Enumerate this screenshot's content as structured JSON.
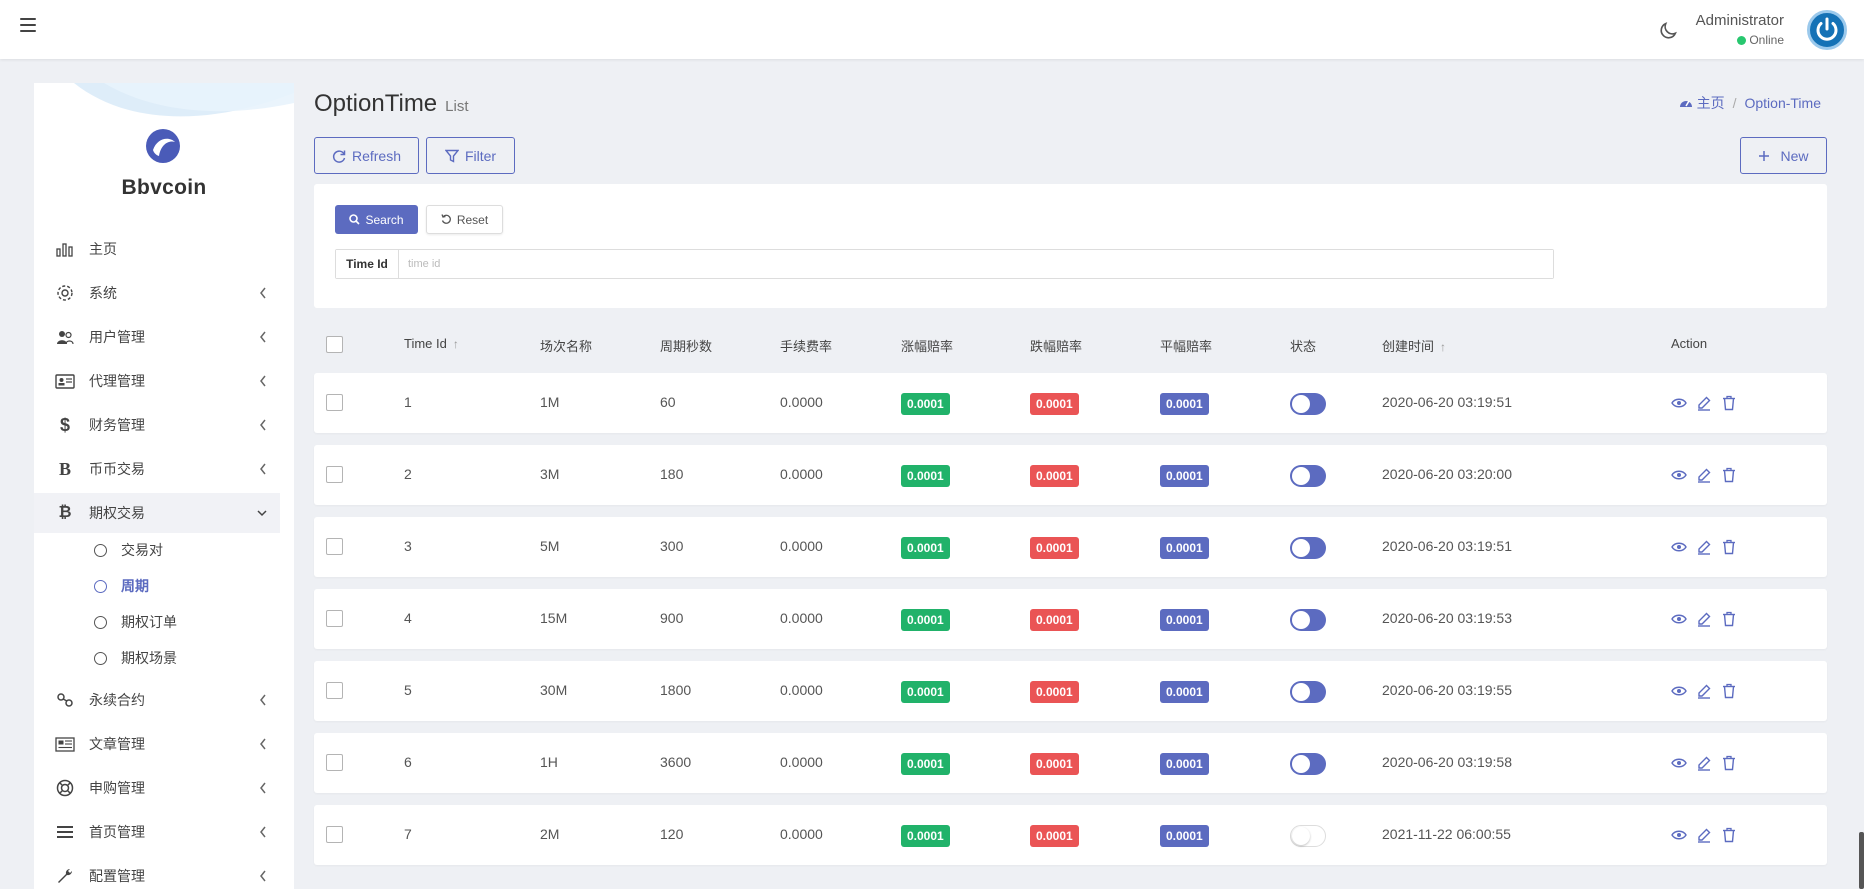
{
  "header": {
    "user_name": "Administrator",
    "user_status": "Online",
    "icons": [
      "hamburger-icon",
      "moon-icon",
      "power-icon"
    ]
  },
  "sidebar": {
    "brand": "Bbvcoin",
    "items": [
      {
        "label": "主页",
        "icon": "bar-chart-icon"
      },
      {
        "label": "系统",
        "icon": "gear-icon"
      },
      {
        "label": "用户管理",
        "icon": "users-icon"
      },
      {
        "label": "代理管理",
        "icon": "id-card-icon"
      },
      {
        "label": "财务管理",
        "icon": "dollar-icon"
      },
      {
        "label": "币币交易",
        "icon": "bold-b-icon"
      },
      {
        "label": "期权交易",
        "icon": "bitcoin-icon"
      },
      {
        "label": "永续合约",
        "icon": "link-icon"
      },
      {
        "label": "文章管理",
        "icon": "newspaper-icon"
      },
      {
        "label": "申购管理",
        "icon": "life-ring-icon"
      },
      {
        "label": "首页管理",
        "icon": "list-icon"
      },
      {
        "label": "配置管理",
        "icon": "wrench-icon"
      }
    ],
    "subitems": [
      {
        "label": "交易对"
      },
      {
        "label": "周期"
      },
      {
        "label": "期权订单"
      },
      {
        "label": "期权场景"
      }
    ]
  },
  "page": {
    "title": "OptionTime",
    "subtitle": "List",
    "breadcrumb_home": "主页",
    "breadcrumb_current": "Option-Time"
  },
  "toolbar": {
    "refresh_label": "Refresh",
    "filter_label": "Filter",
    "new_label": "New"
  },
  "filter": {
    "search_label": "Search",
    "reset_label": "Reset",
    "field_label": "Time Id",
    "field_placeholder": "time id",
    "field_value": ""
  },
  "table": {
    "columns": [
      "Time Id",
      "场次名称",
      "周期秒数",
      "手续费率",
      "涨幅赔率",
      "跌幅赔率",
      "平幅赔率",
      "状态",
      "创建时间",
      "Action"
    ],
    "rows": [
      {
        "id": "1",
        "name": "1M",
        "seconds": "60",
        "fee": "0.0000",
        "up": "0.0001",
        "down": "0.0001",
        "flat": "0.0001",
        "status": true,
        "created": "2020-06-20 03:19:51"
      },
      {
        "id": "2",
        "name": "3M",
        "seconds": "180",
        "fee": "0.0000",
        "up": "0.0001",
        "down": "0.0001",
        "flat": "0.0001",
        "status": true,
        "created": "2020-06-20 03:20:00"
      },
      {
        "id": "3",
        "name": "5M",
        "seconds": "300",
        "fee": "0.0000",
        "up": "0.0001",
        "down": "0.0001",
        "flat": "0.0001",
        "status": true,
        "created": "2020-06-20 03:19:51"
      },
      {
        "id": "4",
        "name": "15M",
        "seconds": "900",
        "fee": "0.0000",
        "up": "0.0001",
        "down": "0.0001",
        "flat": "0.0001",
        "status": true,
        "created": "2020-06-20 03:19:53"
      },
      {
        "id": "5",
        "name": "30M",
        "seconds": "1800",
        "fee": "0.0000",
        "up": "0.0001",
        "down": "0.0001",
        "flat": "0.0001",
        "status": true,
        "created": "2020-06-20 03:19:55"
      },
      {
        "id": "6",
        "name": "1H",
        "seconds": "3600",
        "fee": "0.0000",
        "up": "0.0001",
        "down": "0.0001",
        "flat": "0.0001",
        "status": true,
        "created": "2020-06-20 03:19:58"
      },
      {
        "id": "7",
        "name": "2M",
        "seconds": "120",
        "fee": "0.0000",
        "up": "0.0001",
        "down": "0.0001",
        "flat": "0.0001",
        "status": false,
        "created": "2021-11-22 06:00:55"
      }
    ],
    "action_icons": [
      "eye-icon",
      "edit-icon",
      "trash-icon"
    ]
  },
  "colors": {
    "accent": "#5c6bc0",
    "green": "#21b26a",
    "red": "#ea5455",
    "online": "#28c76f"
  }
}
